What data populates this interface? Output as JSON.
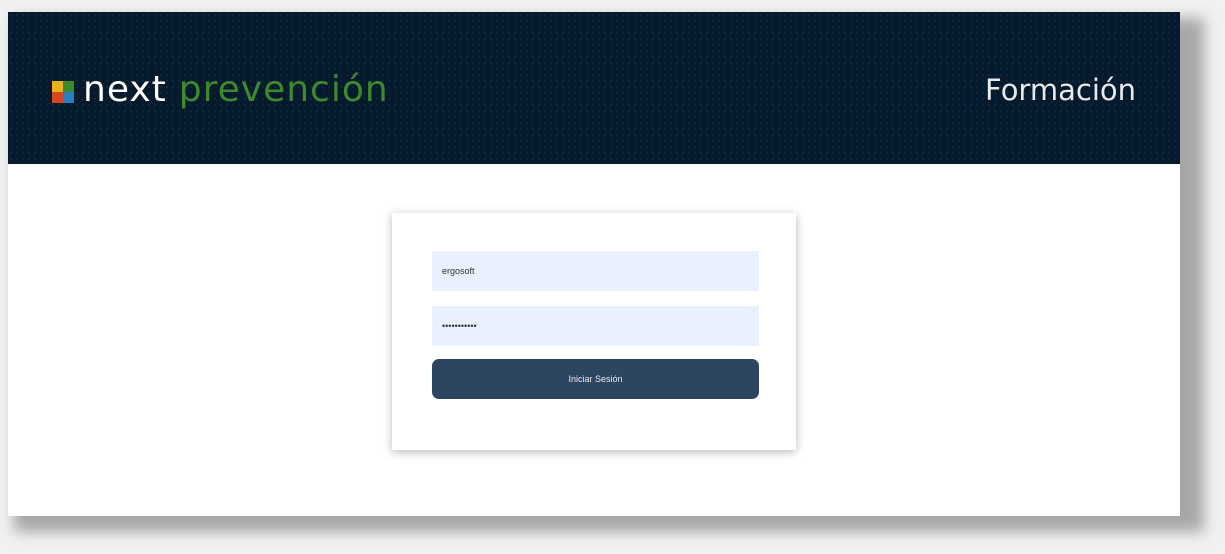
{
  "header": {
    "brand_primary": "next",
    "brand_secondary": "prevención",
    "section_title": "Formación",
    "logo_colors": [
      "#e8b21c",
      "#3c8a2e",
      "#d64521",
      "#2a7fc1"
    ],
    "background_color": "#051a2c"
  },
  "login": {
    "username_value": "ergosoft",
    "password_value": "•••••••••••",
    "submit_label": "Iniciar Sesión",
    "field_background": "#e8f0fe",
    "button_color": "#2d4560"
  }
}
